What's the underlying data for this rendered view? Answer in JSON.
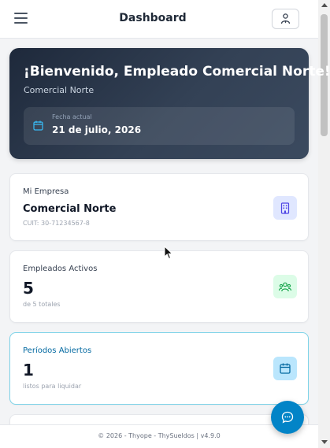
{
  "header": {
    "title": "Dashboard"
  },
  "hero": {
    "title": "¡Bienvenido, Empleado Comercial Norte!",
    "subtitle": "Comercial Norte",
    "date_label": "Fecha actual",
    "date_value": "21 de julio, 2026"
  },
  "cards": [
    {
      "label": "Mi Empresa",
      "value": "Comercial Norte",
      "sub": "CUIT: 30-71234567-8",
      "icon": "building-icon",
      "color": "#4f46e5",
      "bg": "#e0e7ff"
    },
    {
      "label": "Empleados Activos",
      "value": "5",
      "sub": "de 5 totales",
      "icon": "users-icon",
      "color": "#16a34a",
      "bg": "#dcfce7"
    },
    {
      "label": "Períodos Abiertos",
      "value": "1",
      "sub": "listos para liquidar",
      "icon": "calendar-icon",
      "color": "#0369a1",
      "bg": "#bae6fd"
    }
  ],
  "footer": {
    "text": "© 2026 - Thyope - ThySueldos | v4.9.0"
  },
  "colors": {
    "accent": "#0284c7",
    "hero_bg": "#1e293b"
  }
}
